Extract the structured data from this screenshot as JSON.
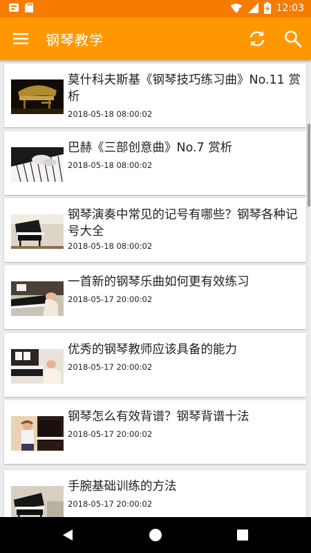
{
  "status_bar": {
    "time": "12:03"
  },
  "app_bar": {
    "title": "钢琴教学"
  },
  "articles": [
    {
      "title": "莫什科夫斯基《钢琴技巧练习曲》No.11 赏析",
      "date": "2018-05-18 08:00:02",
      "thumb": "grand-piano"
    },
    {
      "title": "巴赫《三部创意曲》No.7 赏析",
      "date": "2018-05-18 08:00:02",
      "thumb": "hands-keys"
    },
    {
      "title": "钢琴演奏中常见的记号有哪些？钢琴各种记号大全",
      "date": "2018-05-18 08:00:02",
      "thumb": "grand-piano-room"
    },
    {
      "title": "一首新的钢琴乐曲如何更有效练习",
      "date": "2018-05-17 20:00:02",
      "thumb": "player-keys"
    },
    {
      "title": "优秀的钢琴教师应该具备的能力",
      "date": "2018-05-17 20:00:02",
      "thumb": "teacher-piano"
    },
    {
      "title": "钢琴怎么有效背谱？钢琴背谱十法",
      "date": "2018-05-17 20:00:02",
      "thumb": "boy-piano"
    },
    {
      "title": "手腕基础训练的方法",
      "date": "2018-05-17 20:00:02",
      "thumb": "grand-piano-keys"
    }
  ]
}
